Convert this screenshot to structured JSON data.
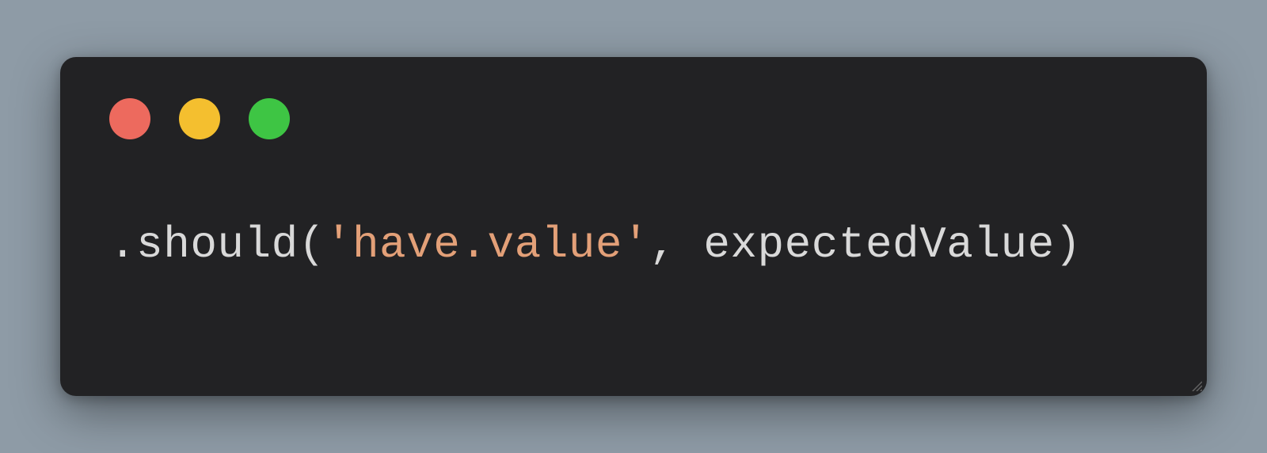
{
  "window": {
    "traffic_lights": {
      "red": "close",
      "yellow": "minimize",
      "green": "maximize"
    }
  },
  "code": {
    "tokens": [
      {
        "text": ".should(",
        "class": "tok-default"
      },
      {
        "text": "'have.value'",
        "class": "tok-string"
      },
      {
        "text": ", expectedValue)",
        "class": "tok-default"
      }
    ]
  },
  "colors": {
    "background": "#8e9ba6",
    "window_bg": "#222224",
    "text_default": "#d9d9d9",
    "text_string": "#e3a078",
    "red": "#ed6a5e",
    "yellow": "#f4bf2f",
    "green": "#3ec544"
  }
}
